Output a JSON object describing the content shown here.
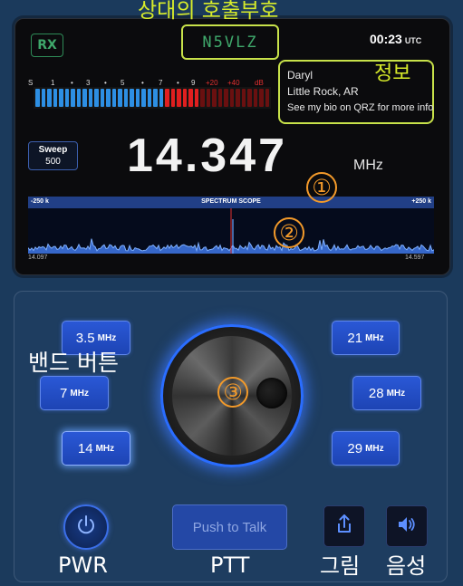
{
  "annotations": {
    "callsign_label": "상대의 호출부호",
    "info_label": "정보",
    "band_label": "밴드 버튼",
    "num1": "①",
    "num2": "②",
    "num3": "③",
    "pwr_label": "PWR",
    "ptt_label": "PTT",
    "share_label": "그림",
    "audio_label": "음성"
  },
  "display": {
    "rx_label": "RX",
    "callsign": "N5VLZ",
    "time": "00:23",
    "time_zone": "UTC",
    "info": {
      "name": "Daryl",
      "location": "Little Rock, AR",
      "bio": "See my bio on QRZ for more info"
    },
    "smeter": {
      "scale": [
        "S",
        "1",
        "•",
        "3",
        "•",
        "5",
        "•",
        "7",
        "•",
        "9",
        "+20",
        "+40",
        "dB"
      ],
      "blue_level_segments": 22,
      "red_level_segments": 12,
      "total_segments": 40,
      "colors": {
        "blue": "#2d8fe3",
        "red_active": "#e01f1f",
        "red_dim": "#6a1010"
      }
    },
    "sweep": {
      "label": "Sweep",
      "value": "500"
    },
    "frequency": "14.347",
    "frequency_unit": "MHz",
    "spectrum": {
      "left_label": "-250 k",
      "title": "SPECTRUM SCOPE",
      "right_label": "+250 k",
      "lo_freq": "14.097",
      "hi_freq": "14.597"
    }
  },
  "bands": {
    "b35": {
      "num": "3.5",
      "unit": "MHz"
    },
    "b7": {
      "num": "7",
      "unit": "MHz"
    },
    "b14": {
      "num": "14",
      "unit": "MHz"
    },
    "b21": {
      "num": "21",
      "unit": "MHz"
    },
    "b28": {
      "num": "28",
      "unit": "MHz"
    },
    "b29": {
      "num": "29",
      "unit": "MHz"
    },
    "active": "14"
  },
  "ptt_button": "Push to Talk",
  "icons": {
    "power": "power-icon",
    "share": "share-icon",
    "speaker": "speaker-icon"
  },
  "accent_color": "#2a58d6",
  "annotation_color": "#d8ec2a"
}
